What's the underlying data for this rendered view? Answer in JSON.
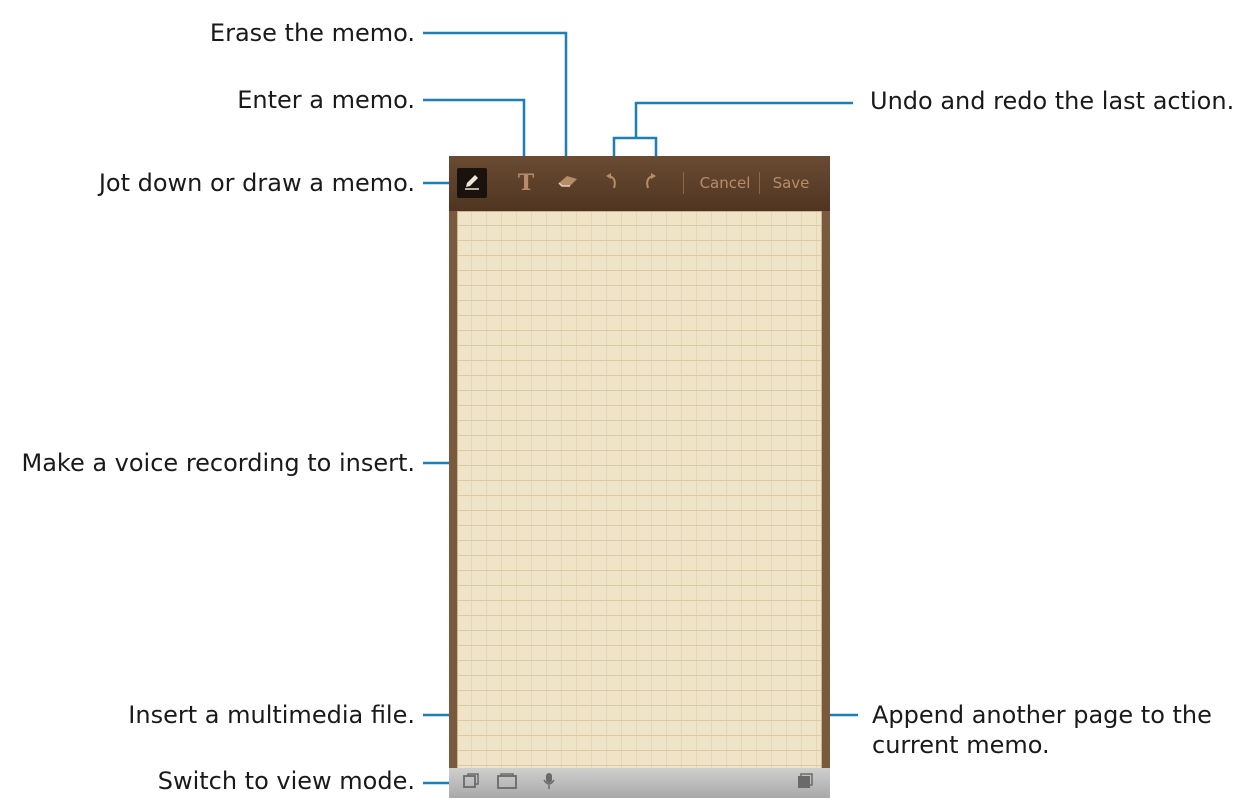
{
  "callouts": {
    "erase": "Erase the memo.",
    "enter": "Enter a memo.",
    "jot": "Jot down or draw a memo.",
    "undo_redo": "Undo and redo the last action.",
    "voice": "Make a voice recording to insert.",
    "multimedia": "Insert a multimedia file.",
    "view_mode": "Switch to view mode.",
    "append_line1": "Append another page to the",
    "append_line2": "current memo."
  },
  "toolbar": {
    "cancel_label": "Cancel",
    "save_label": "Save"
  },
  "colors": {
    "leader_line": "#1f7fb5",
    "toolbar_bg": "#5a3e29",
    "paper": "#efe3c8"
  },
  "icons": [
    "pen-icon",
    "text-icon",
    "eraser-icon",
    "undo-icon",
    "redo-icon",
    "view-mode-icon",
    "multimedia-icon",
    "microphone-icon",
    "add-page-icon"
  ]
}
